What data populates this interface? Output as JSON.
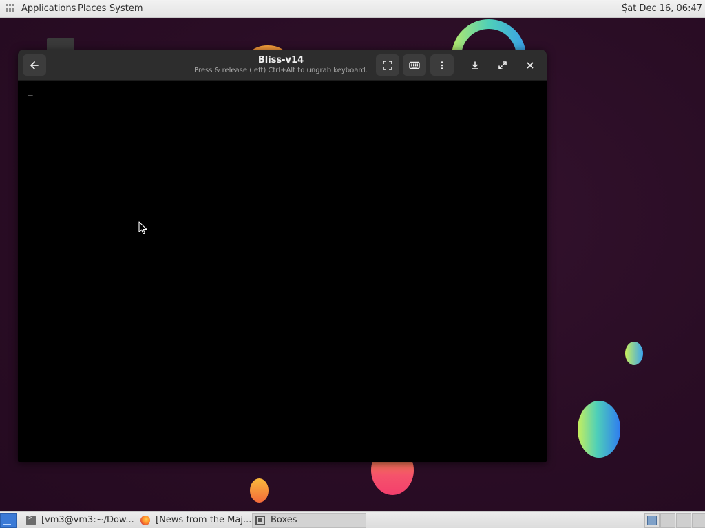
{
  "top_panel": {
    "menus": {
      "applications": "Applications",
      "places": "Places",
      "system": "System"
    },
    "clock": "Sat Dec 16, 06:47"
  },
  "window": {
    "title": "Bliss-v14",
    "subtitle": "Press & release (left) Ctrl+Alt to ungrab keyboard.",
    "buttons": {
      "back": "arrow-left-icon",
      "fullscreen": "fullscreen-icon",
      "keyboard": "keyboard-icon",
      "menu": "kebab-menu-icon",
      "download": "download-icon",
      "maximize": "maximize-icon",
      "close": "close-icon"
    },
    "display": {
      "console_cursor": "_"
    }
  },
  "taskbar": {
    "tasks": [
      {
        "label": "[vm3@vm3:~/Dow...",
        "icon": "terminal-icon"
      },
      {
        "label": "[News from the Maj...",
        "icon": "firefox-icon"
      },
      {
        "label": "Boxes",
        "icon": "boxes-icon",
        "active": true
      }
    ],
    "workspaces": [
      {
        "active": true
      },
      {
        "active": false
      },
      {
        "active": false
      },
      {
        "active": false
      }
    ]
  },
  "colors": {
    "desktop_bg": "#2a0d25",
    "panel_bg": "#e6e6e6",
    "headerbar_bg": "#2d2d2d",
    "accent_blue": "#3b7ad6"
  }
}
